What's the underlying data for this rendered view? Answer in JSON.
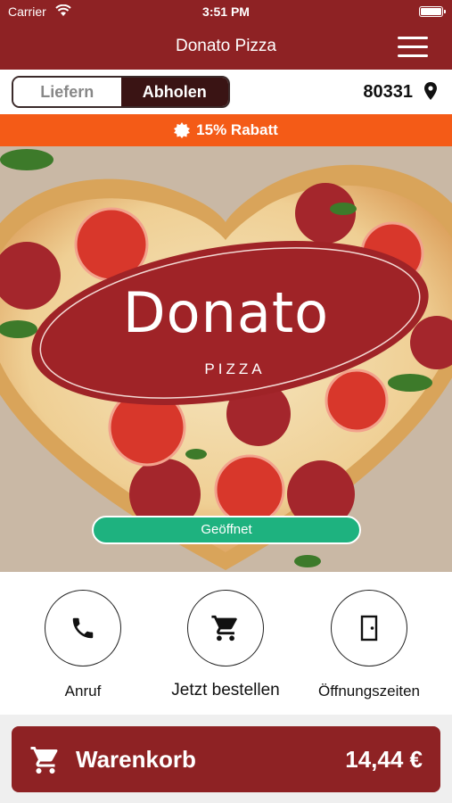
{
  "status_bar": {
    "carrier": "Carrier",
    "time": "3:51 PM",
    "icons": [
      "wifi-icon",
      "battery-icon"
    ]
  },
  "nav": {
    "title": "Donato Pizza",
    "menu_icon": "hamburger-menu-icon"
  },
  "delivery_mode": {
    "options": [
      {
        "label": "Liefern",
        "selected": false
      },
      {
        "label": "Abholen",
        "selected": true
      }
    ],
    "zip": "80331",
    "location_icon": "location-pin-icon"
  },
  "discount": {
    "icon": "badge-icon",
    "text": "15% Rabatt"
  },
  "hero": {
    "logo_name": "Donato",
    "logo_sub": "PIZZA",
    "status_label": "Geöffnet"
  },
  "actions": [
    {
      "label": "Anruf",
      "icon": "phone-icon"
    },
    {
      "label": "Jetzt bestellen",
      "icon": "shopping-cart-icon"
    },
    {
      "label": "Öffnungszeiten",
      "icon": "door-icon"
    }
  ],
  "cart": {
    "label": "Warenkorb",
    "total": "14,44 €",
    "icon": "shopping-cart-icon"
  },
  "colors": {
    "brand": "#8e2224",
    "discount": "#f45b17",
    "open": "#1eb27f",
    "segment_active": "#3a1414"
  }
}
